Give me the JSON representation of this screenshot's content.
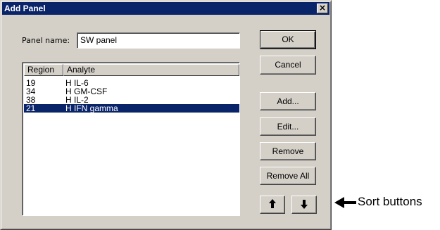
{
  "dialog": {
    "title": "Add Panel",
    "close_label": "×"
  },
  "panel_name": {
    "label": "Panel name:",
    "value": "SW panel"
  },
  "list": {
    "columns": [
      "Region",
      "Analyte"
    ],
    "rows": [
      {
        "region": "19",
        "analyte": "H IL-6",
        "selected": false
      },
      {
        "region": "34",
        "analyte": "H GM-CSF",
        "selected": false
      },
      {
        "region": "38",
        "analyte": "H IL-2",
        "selected": false
      },
      {
        "region": "21",
        "analyte": "H IFN gamma",
        "selected": true
      }
    ]
  },
  "buttons": {
    "ok": "OK",
    "cancel": "Cancel",
    "add": "Add...",
    "edit": "Edit...",
    "remove": "Remove",
    "remove_all": "Remove All",
    "sort_up_icon": "arrow-up-icon",
    "sort_down_icon": "arrow-down-icon"
  },
  "annotation": {
    "text": "Sort buttons",
    "icon": "arrow-left-icon"
  },
  "colors": {
    "face": "#d4d0c8",
    "titlebar": "#0a246a",
    "selection": "#0a246a"
  }
}
